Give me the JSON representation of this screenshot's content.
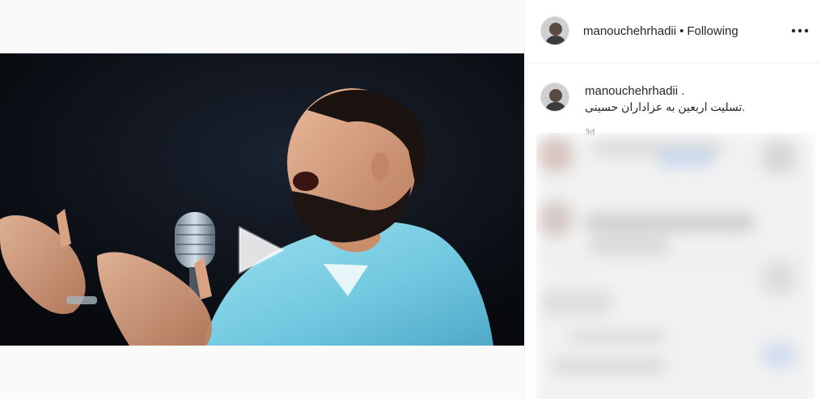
{
  "post": {
    "username": "manouchehrhadii",
    "separator": "•",
    "follow_status": "Following",
    "more_label": "•••",
    "caption_user": "manouchehrhadii .",
    "caption_text": "تسلیت اربعین به عزاداران حسینی.",
    "timestamp": "3d"
  },
  "media": {
    "type": "video",
    "play_icon": "play-icon"
  },
  "colors": {
    "text": "#262626",
    "muted": "#8e8e8e",
    "border": "#efefef",
    "video_bg": "#0b0d10"
  }
}
